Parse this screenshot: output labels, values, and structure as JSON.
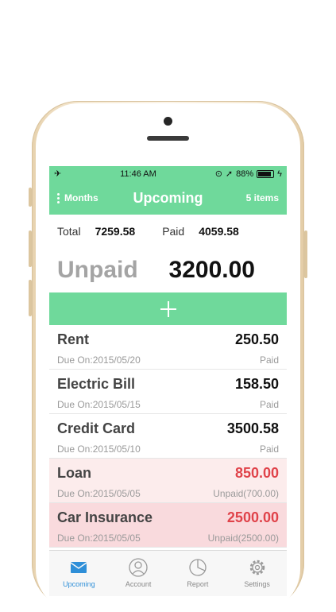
{
  "status_bar": {
    "time": "11:46 AM",
    "battery": "88%"
  },
  "navbar": {
    "left_label": "Months",
    "title": "Upcoming",
    "right_label": "5 items"
  },
  "summary": {
    "total_label": "Total",
    "total_value": "7259.58",
    "paid_label": "Paid",
    "paid_value": "4059.58"
  },
  "unpaid": {
    "label": "Unpaid",
    "value": "3200.00"
  },
  "bills": [
    {
      "name": "Rent",
      "amount": "250.50",
      "due": "Due On:2015/05/20",
      "status": "Paid"
    },
    {
      "name": "Electric Bill",
      "amount": "158.50",
      "due": "Due On:2015/05/15",
      "status": "Paid"
    },
    {
      "name": "Credit Card",
      "amount": "3500.58",
      "due": "Due On:2015/05/10",
      "status": "Paid"
    },
    {
      "name": "Loan",
      "amount": "850.00",
      "due": "Due On:2015/05/05",
      "status": "Unpaid(700.00)"
    },
    {
      "name": "Car Insurance",
      "amount": "2500.00",
      "due": "Due On:2015/05/05",
      "status": "Unpaid(2500.00)"
    }
  ],
  "tabs": [
    {
      "label": "Upcoming",
      "icon": "envelope-icon"
    },
    {
      "label": "Account",
      "icon": "user-icon"
    },
    {
      "label": "Report",
      "icon": "pie-chart-icon"
    },
    {
      "label": "Settings",
      "icon": "gear-icon"
    }
  ],
  "colors": {
    "accent_green": "#6fd99b",
    "tab_active": "#2f8fd8",
    "unpaid_red": "#e0434a"
  }
}
